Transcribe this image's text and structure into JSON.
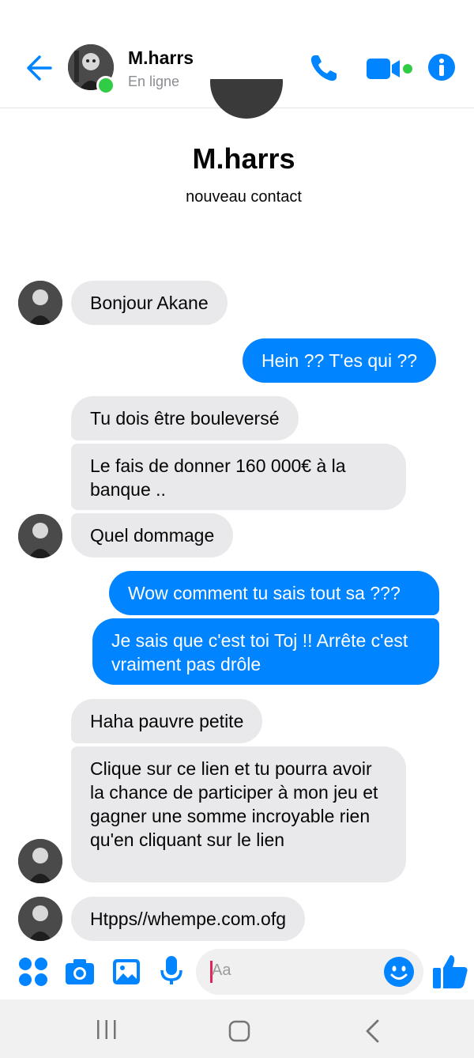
{
  "header": {
    "contact_name": "M.harrs",
    "status": "En ligne"
  },
  "profile": {
    "name": "M.harrs",
    "subtitle": "nouveau contact"
  },
  "messages": [
    {
      "from": "them",
      "text": "Bonjour Akane"
    },
    {
      "from": "me",
      "text": "Hein ?? T'es qui ??"
    },
    {
      "from": "them",
      "text": "Tu dois être bouleversé"
    },
    {
      "from": "them",
      "text": "Le fais de donner 160 000€ à la banque .."
    },
    {
      "from": "them",
      "text": "Quel dommage"
    },
    {
      "from": "me",
      "text": "Wow comment tu sais tout sa ???"
    },
    {
      "from": "me",
      "text": "Je sais que c'est toi Toj !! Arrête c'est vraiment pas drôle"
    },
    {
      "from": "them",
      "text": "Haha pauvre petite"
    },
    {
      "from": "them",
      "text": "Clique sur ce lien et tu pourra avoir la chance de participer à mon jeu et gagner une somme incroyable rien qu'en cliquant sur le lien"
    },
    {
      "from": "them",
      "text": "Htpps//whempe.com.ofg"
    }
  ],
  "composer": {
    "placeholder": "Aa"
  },
  "colors": {
    "accent": "#0084ff",
    "incoming_bubble": "#e9e9eb",
    "online": "#31cc46"
  },
  "icons": {
    "back": "arrow-left-icon",
    "call": "phone-icon",
    "video": "video-camera-icon",
    "info": "info-icon",
    "apps": "grid-dots-icon",
    "camera": "camera-icon",
    "gallery": "image-icon",
    "voice": "microphone-icon",
    "emoji": "emoji-icon",
    "like": "thumbs-up-icon"
  }
}
